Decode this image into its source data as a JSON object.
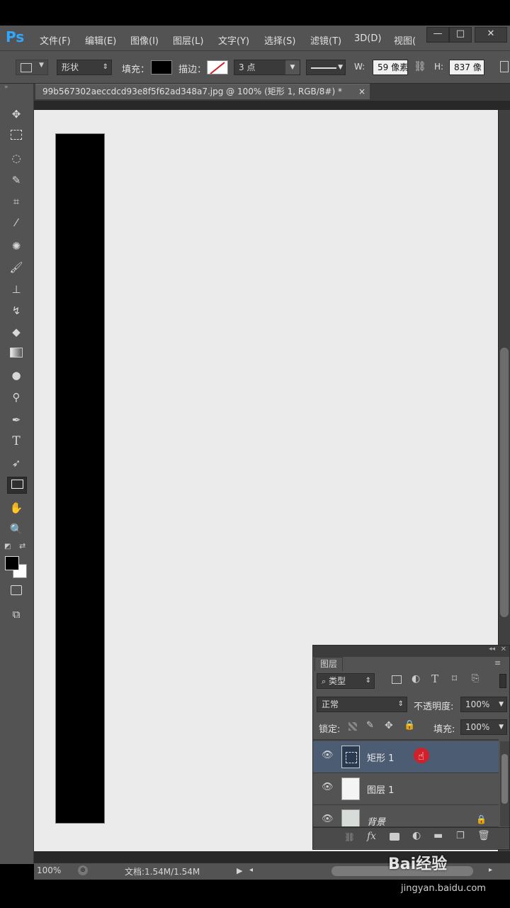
{
  "app": {
    "logo": "Ps",
    "menu": [
      "文件(F)",
      "编辑(E)",
      "图像(I)",
      "图层(L)",
      "文字(Y)",
      "选择(S)",
      "滤镜(T)",
      "3D(D)",
      "视图("
    ],
    "window_buttons": [
      "—",
      "□",
      "✕"
    ]
  },
  "options": {
    "mode": "形状",
    "fill_label": "填充：",
    "stroke_label": "描边：",
    "stroke_width": "3 点",
    "w_label": "W:",
    "w_value": "59 像素",
    "h_label": "H:",
    "h_value": "837 像",
    "fill_color": "#000000"
  },
  "document": {
    "tab_title": "99b567302aeccdcd93e8f5f62ad348a7.jpg @ 100% (矩形 1, RGB/8#) *",
    "tab_close": "×"
  },
  "status": {
    "zoom": "100%",
    "doc_info": "文档:1.54M/1.54M"
  },
  "layers_panel": {
    "tab": "图层",
    "filter_kind": "类型",
    "blend_mode": "正常",
    "opacity_label": "不透明度:",
    "opacity_value": "100%",
    "lock_label": "锁定:",
    "fill_label": "填充:",
    "fill_value": "100%",
    "layers": [
      {
        "name": "矩形 1",
        "selected": true
      },
      {
        "name": "图层 1",
        "selected": false
      },
      {
        "name": "背景",
        "selected": false
      }
    ],
    "bottom_icons": [
      "link-icon",
      "fx-icon",
      "mask-icon",
      "adjustment-icon",
      "folder-icon",
      "new-layer-icon",
      "trash-icon"
    ]
  },
  "watermark": {
    "brand": "Bai经验",
    "url": "jingyan.baidu.com"
  },
  "colors": {
    "accent": "#31a8ff",
    "selected_layer": "#4b5c73",
    "cursor_dot": "#d0202a"
  }
}
